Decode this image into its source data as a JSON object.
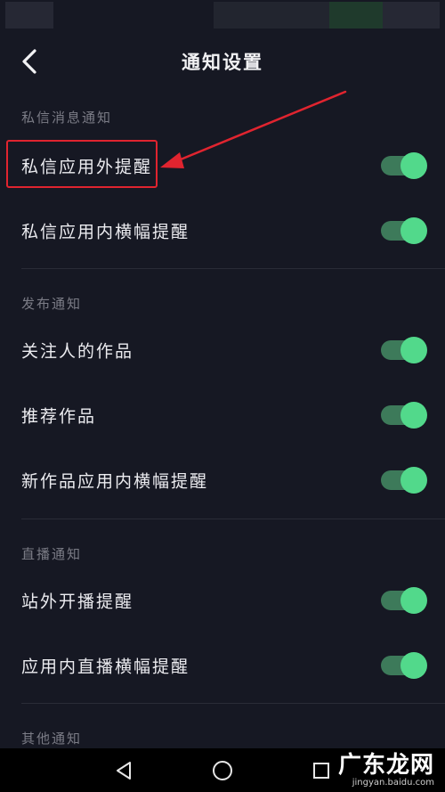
{
  "header": {
    "title": "通知设置",
    "back_icon": "chevron-left-icon"
  },
  "sections": [
    {
      "title": "私信消息通知",
      "items": [
        {
          "label": "私信应用外提醒",
          "enabled": true
        },
        {
          "label": "私信应用内横幅提醒",
          "enabled": true
        }
      ]
    },
    {
      "title": "发布通知",
      "items": [
        {
          "label": "关注人的作品",
          "enabled": true
        },
        {
          "label": "推荐作品",
          "enabled": true
        },
        {
          "label": "新作品应用内横幅提醒",
          "enabled": true
        }
      ]
    },
    {
      "title": "直播通知",
      "items": [
        {
          "label": "站外开播提醒",
          "enabled": true
        },
        {
          "label": "应用内直播横幅提醒",
          "enabled": true
        }
      ]
    },
    {
      "title": "其他通知",
      "items": []
    }
  ],
  "annotation": {
    "color": "#e0242f"
  },
  "colors": {
    "background": "#161823",
    "toggle_on_track": "#3d7a5a",
    "toggle_on_knob": "#52d98b",
    "section_title": "#7b7c86"
  },
  "navbar": {
    "back_icon": "triangle-back-icon",
    "home_icon": "circle-home-icon",
    "recents_icon": "square-recents-icon"
  },
  "watermark": {
    "main": "广东龙网",
    "sub": "jingyan.baidu.com"
  }
}
